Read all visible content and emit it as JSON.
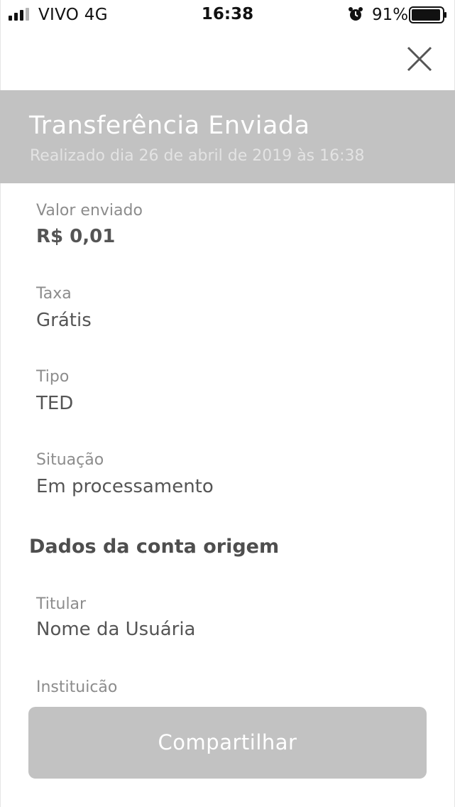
{
  "status_bar": {
    "carrier": "VIVO   4G",
    "time": "16:38",
    "battery_percent": "91%",
    "icons": [
      "signal-icon",
      "alarm-icon",
      "battery-icon"
    ]
  },
  "header": {
    "title": "Transferência Enviada",
    "subtitle": "Realizado dia 26 de abril de 2019 às 16:38"
  },
  "details": {
    "valor_label": "Valor enviado",
    "valor_value": "R$ 0,01",
    "taxa_label": "Taxa",
    "taxa_value": "Grátis",
    "tipo_label": "Tipo",
    "tipo_value": "TED",
    "situacao_label": "Situação",
    "situacao_value": "Em processamento"
  },
  "origem": {
    "section_title": "Dados da conta origem",
    "titular_label": "Titular",
    "titular_value": "Nome da Usuária",
    "instituicao_label": "Instituicão"
  },
  "actions": {
    "share_label": "Compartilhar",
    "close_icon": "close-icon"
  },
  "colors": {
    "header_bg": "#c2c2c2",
    "button_bg": "#c2c2c2",
    "text_primary": "#555555",
    "text_label": "#8c8c8c"
  }
}
